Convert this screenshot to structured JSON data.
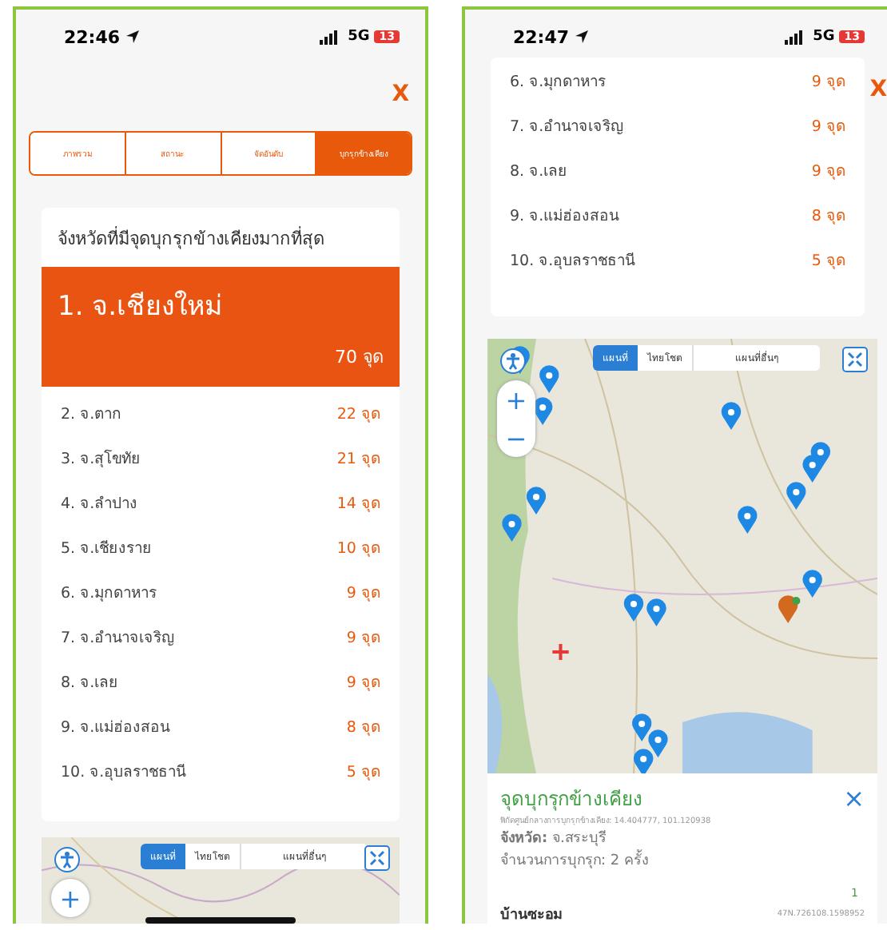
{
  "left_screen": {
    "status": {
      "time": "22:46",
      "network": "5G",
      "battery": "13"
    },
    "close": "X",
    "tabs": [
      {
        "label": "ภาพรวม",
        "selected": false
      },
      {
        "label": "สถานะ",
        "selected": false
      },
      {
        "label": "จัดอันดับ",
        "selected": false
      },
      {
        "label": "บุกรุกข้างเคียง",
        "selected": true
      }
    ],
    "ranking": {
      "title": "จังหวัดที่มีจุดบุกรุกข้างเคียงมากที่สุด",
      "top": {
        "name": "1. จ.เชียงใหม่",
        "count": "70 จุด"
      },
      "rows": [
        {
          "name": "2. จ.ตาก",
          "count": "22 จุด"
        },
        {
          "name": "3. จ.สุโขทัย",
          "count": "21 จุด"
        },
        {
          "name": "4. จ.ลำปาง",
          "count": "14 จุด"
        },
        {
          "name": "5. จ.เชียงราย",
          "count": "10 จุด"
        },
        {
          "name": "6. จ.มุกดาหาร",
          "count": "9 จุด"
        },
        {
          "name": "7. จ.อำนาจเจริญ",
          "count": "9 จุด"
        },
        {
          "name": "8. จ.เลย",
          "count": "9 จุด"
        },
        {
          "name": "9. จ.แม่ฮ่องสอน",
          "count": "8 จุด"
        },
        {
          "name": "10. จ.อุบลราชธานี",
          "count": "5 จุด"
        }
      ]
    },
    "map": {
      "types": [
        {
          "label": "แผนที่",
          "selected": true
        },
        {
          "label": "ไทยโชต",
          "selected": false
        }
      ],
      "other": "แผนที่อื่นๆ",
      "zoom_in": "+"
    }
  },
  "right_screen": {
    "status": {
      "time": "22:47",
      "network": "5G",
      "battery": "13"
    },
    "close": "X",
    "rows": [
      {
        "name": "6. จ.มุกดาหาร",
        "count": "9 จุด"
      },
      {
        "name": "7. จ.อำนาจเจริญ",
        "count": "9 จุด"
      },
      {
        "name": "8. จ.เลย",
        "count": "9 จุด"
      },
      {
        "name": "9. จ.แม่ฮ่องสอน",
        "count": "8 จุด"
      },
      {
        "name": "10. จ.อุบลราชธานี",
        "count": "5 จุด"
      }
    ],
    "map": {
      "types": [
        {
          "label": "แผนที่",
          "selected": true
        },
        {
          "label": "ไทยโชต",
          "selected": false
        }
      ],
      "other": "แผนที่อื่นๆ",
      "zoom_in": "+",
      "zoom_out": "−"
    },
    "popup": {
      "title": "จุดบุกรุกข้างเคียง",
      "close": "×",
      "coords": "พิกัดศูนย์กลางการบุกรุกข้างเคียง: 14.404777, 101.120938",
      "province": "**จังหวัด:** จ.สระบุรี",
      "count": "จำนวนการบุกรุก: 2 ครั้ง",
      "item_number": "1",
      "item_name": "บ้านซะอม",
      "item_coords": "47N.726108.1598952"
    }
  }
}
